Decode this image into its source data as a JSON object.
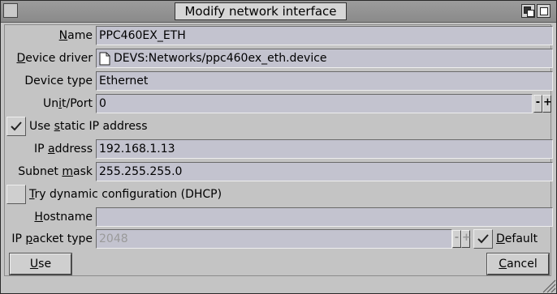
{
  "window": {
    "title": "Modify network interface"
  },
  "form": {
    "name": {
      "label_pre": "",
      "label_u": "N",
      "label_post": "ame",
      "value": "PPC460EX_ETH"
    },
    "device_driver": {
      "label_pre": "",
      "label_u": "D",
      "label_post": "evice driver",
      "value": "DEVS:Networks/ppc460ex_eth.device",
      "icon": "file-icon"
    },
    "device_type": {
      "label": "Device type",
      "value": "Ethernet"
    },
    "unit_port": {
      "label_pre": "Un",
      "label_u": "i",
      "label_post": "t/Port",
      "value": "0",
      "dec": "-",
      "inc": "+"
    },
    "static_ip": {
      "label_pre": "Use ",
      "label_u": "s",
      "label_post": "tatic IP address",
      "checked": true
    },
    "ip_address": {
      "label_pre": "IP ",
      "label_u": "a",
      "label_post": "ddress",
      "value": "192.168.1.13"
    },
    "subnet_mask": {
      "label_pre": "Subnet ",
      "label_u": "m",
      "label_post": "ask",
      "value": "255.255.255.0"
    },
    "dhcp": {
      "label_pre": "",
      "label_u": "T",
      "label_post": "ry dynamic configuration (DHCP)",
      "checked": false
    },
    "hostname": {
      "label_pre": "",
      "label_u": "H",
      "label_post": "ostname",
      "value": ""
    },
    "packet_type": {
      "label_pre": "IP ",
      "label_u": "p",
      "label_post": "acket type",
      "value": "2048",
      "dec": "-",
      "inc": "+"
    },
    "default": {
      "label_pre": "",
      "label_u": "D",
      "label_post": "efault",
      "checked": true
    }
  },
  "buttons": {
    "use": {
      "label_u": "U",
      "label_post": "se"
    },
    "cancel": {
      "label_u": "C",
      "label_post": "ancel"
    }
  },
  "colors": {
    "field_bg": "#c3c3cf",
    "window_bg": "#c4c4c4",
    "titlebar": "#8f8f8f"
  }
}
